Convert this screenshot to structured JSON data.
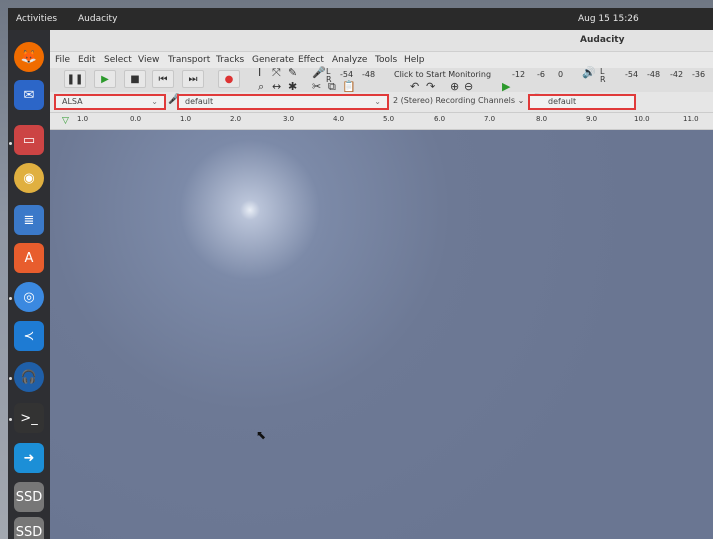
{
  "top_bar": {
    "activities": "Activities",
    "app_menu": "Audacity",
    "clock": "Aug 15  15:26"
  },
  "window": {
    "title": "Audacity"
  },
  "menu": [
    "File",
    "Edit",
    "Select",
    "View",
    "Transport",
    "Tracks",
    "Generate",
    "Effect",
    "Analyze",
    "Tools",
    "Help"
  ],
  "toolbar": {
    "meter_left_label": "L",
    "meter_right_label": "R",
    "monitor_text": "Click to Start Monitoring",
    "record_meter_scale": [
      "-54",
      "-48",
      "-12",
      "-6",
      "0"
    ],
    "play_meter_scale": [
      "-54",
      "-48",
      "-42",
      "-36"
    ]
  },
  "device": {
    "host": "ALSA",
    "recording_device": "default",
    "channels": "2 (Stereo) Recording Channels",
    "playback_device": "default"
  },
  "ruler": {
    "ticks": [
      "1.0",
      "0.0",
      "1.0",
      "2.0",
      "3.0",
      "4.0",
      "5.0",
      "6.0",
      "7.0",
      "8.0",
      "9.0",
      "10.0",
      "11.0"
    ]
  }
}
